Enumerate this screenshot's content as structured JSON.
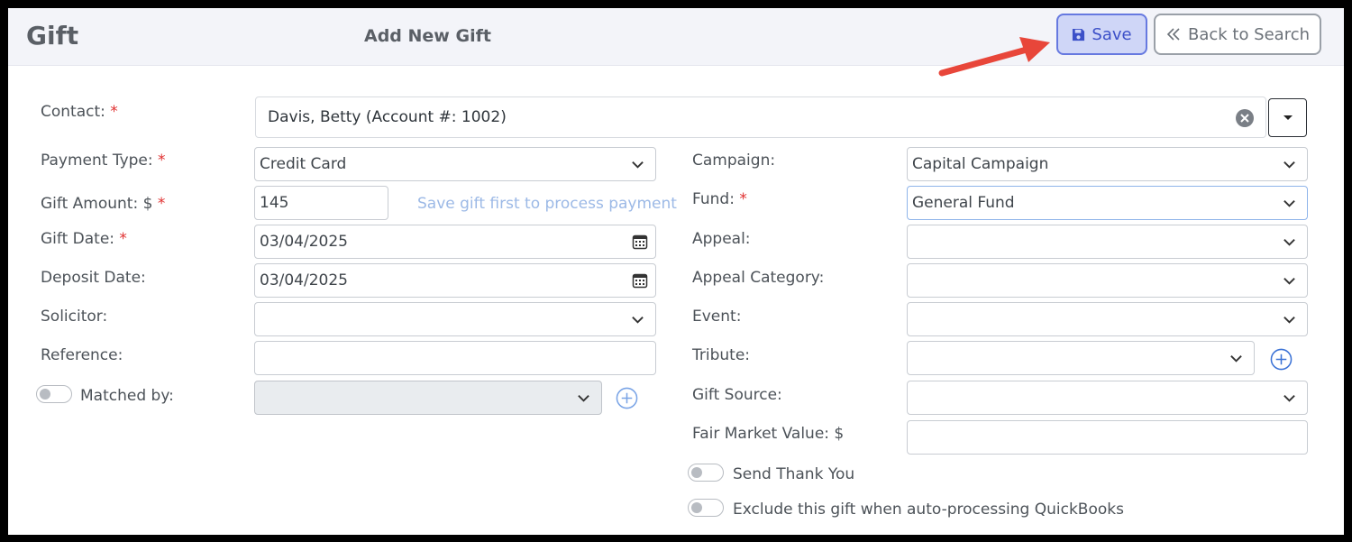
{
  "header": {
    "title": "Gift",
    "subtitle": "Add New Gift",
    "save_label": "Save",
    "back_label": "Back to Search"
  },
  "contact": {
    "label": "Contact:",
    "value": "Davis, Betty (Account #: 1002)"
  },
  "left": {
    "payment_type": {
      "label": "Payment Type:",
      "value": "Credit Card"
    },
    "gift_amount": {
      "label": "Gift Amount: $",
      "value": "145",
      "hint": "Save gift first to process payment"
    },
    "gift_date": {
      "label": "Gift Date:",
      "value": "03/04/2025"
    },
    "deposit_date": {
      "label": "Deposit Date:",
      "value": "03/04/2025"
    },
    "solicitor": {
      "label": "Solicitor:",
      "value": ""
    },
    "reference": {
      "label": "Reference:",
      "value": ""
    },
    "matched_by": {
      "label": "Matched by:",
      "value": ""
    }
  },
  "right": {
    "campaign": {
      "label": "Campaign:",
      "value": "Capital Campaign"
    },
    "fund": {
      "label": "Fund:",
      "value": "General Fund"
    },
    "appeal": {
      "label": "Appeal:",
      "value": ""
    },
    "appeal_category": {
      "label": "Appeal Category:",
      "value": ""
    },
    "event": {
      "label": "Event:",
      "value": ""
    },
    "tribute": {
      "label": "Tribute:",
      "value": ""
    },
    "gift_source": {
      "label": "Gift Source:",
      "value": ""
    },
    "fair_market_value": {
      "label": "Fair Market Value: $",
      "value": ""
    },
    "send_thank_you": {
      "label": "Send Thank You",
      "on": false
    },
    "exclude_quickbooks": {
      "label": "Exclude this gift when auto-processing QuickBooks",
      "on": false
    }
  },
  "required_marker": "*",
  "colors": {
    "accent": "#3c50c8",
    "required": "#e03030",
    "hint": "#9cb9e6",
    "arrow": "#e8463a"
  }
}
